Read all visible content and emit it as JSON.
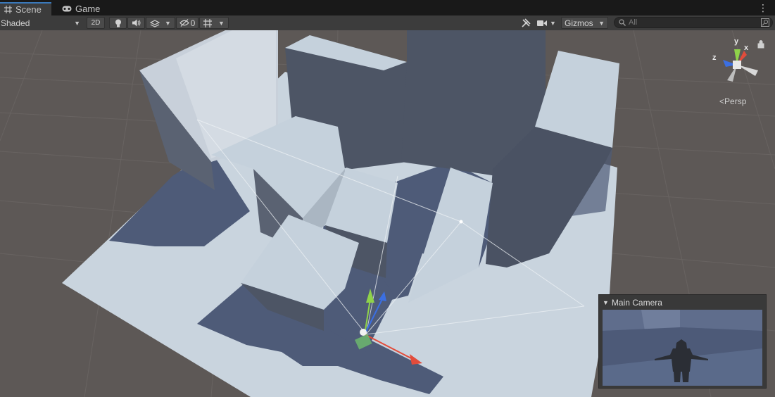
{
  "tabs": [
    {
      "label": "Scene",
      "icon": "grid-icon",
      "active": true
    },
    {
      "label": "Game",
      "icon": "gamepad-icon",
      "active": false
    }
  ],
  "toolbar": {
    "shading_mode": "Shaded",
    "mode_2d": "2D",
    "hidden_count": "0",
    "gizmos": "Gizmos",
    "search_placeholder": "All"
  },
  "scene": {
    "projection": "Persp",
    "axes": {
      "x": "x",
      "y": "y",
      "z": "z"
    }
  },
  "camera_preview": {
    "title": "Main Camera"
  },
  "colors": {
    "accent": "#3a79bb",
    "ground": "#5d5856",
    "block_light": "#c5d1dc",
    "block_dark": "#4d5565",
    "axis_x": "#e24c3b",
    "axis_y": "#8fd34a",
    "axis_z": "#3b6fe2"
  }
}
